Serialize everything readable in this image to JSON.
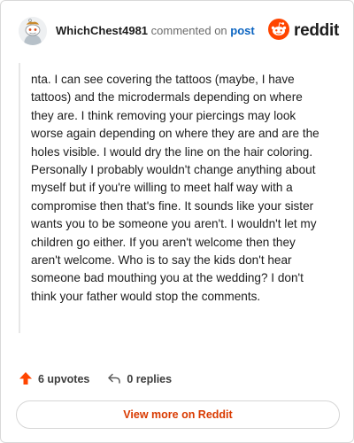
{
  "header": {
    "username": "WhichChest4981",
    "commented_text": "commented on",
    "post_link": "post",
    "brand_name": "reddit",
    "avatar_icon": "snoo-avatar-icon",
    "brand_icon": "reddit-logo-icon"
  },
  "comment": {
    "text": "nta. I can see covering the tattoos (maybe, I have tattoos) and the microdermals depending on where they are. I think removing your piercings may look worse again depending on where they are and are the holes visible. I would dry the line on the hair coloring. Personally I probably wouldn't change anything about myself but if you're willing to meet half way with a compromise then that's fine. It sounds like your sister wants you to be someone you aren't. I wouldn't let my children go either. If you aren't welcome then they aren't welcome. Who is to say the kids don't hear someone bad mouthing you at the wedding? I don't think your father would stop the comments."
  },
  "actions": {
    "upvotes_label": "6 upvotes",
    "replies_label": "0 replies",
    "upvote_icon": "upvote-arrow-icon",
    "reply_icon": "reply-arrow-icon"
  },
  "footer": {
    "view_more_label": "View more on Reddit"
  },
  "colors": {
    "brand_orange": "#ff4500",
    "link_blue": "#0b64c1",
    "button_text": "#d93a00"
  }
}
